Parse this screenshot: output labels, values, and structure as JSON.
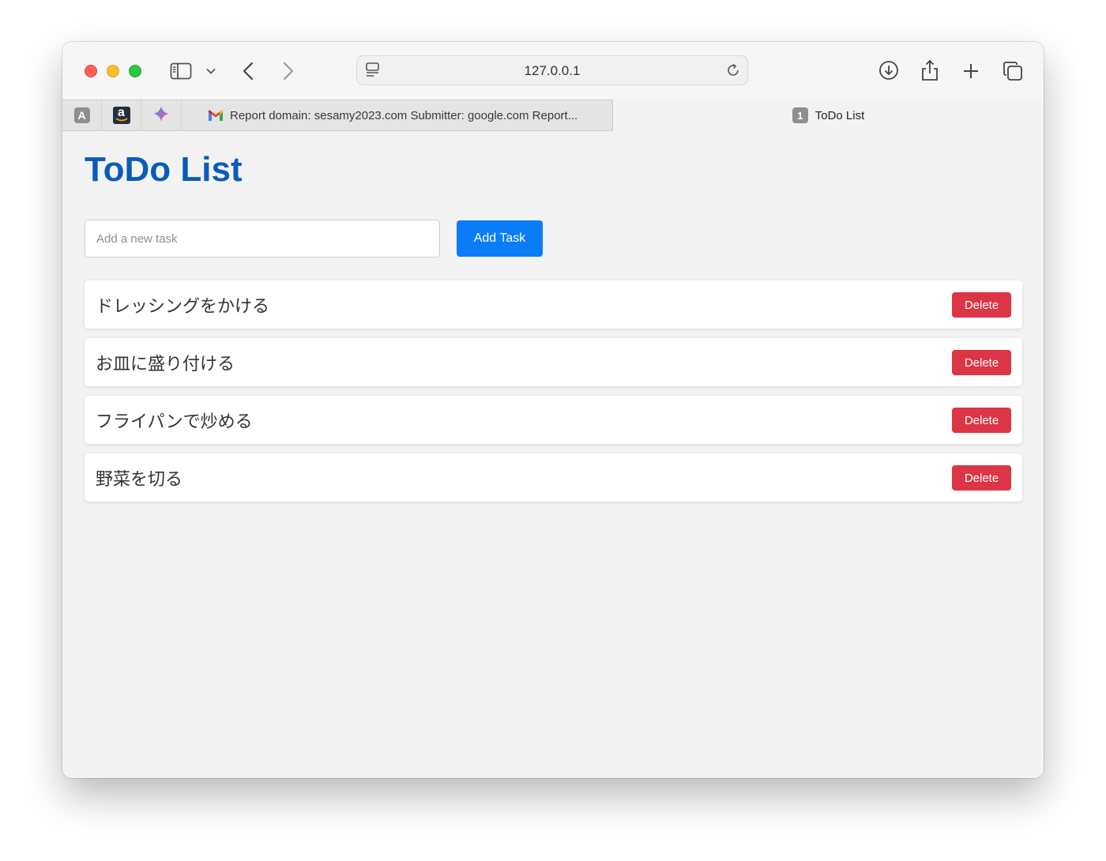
{
  "browser": {
    "url": "127.0.0.1",
    "pinned_tabs": [
      {
        "icon": "a-letter-icon",
        "label": "A"
      },
      {
        "icon": "amazon-icon",
        "label": "a"
      },
      {
        "icon": "sparkle-icon",
        "label": ""
      }
    ],
    "tabs": [
      {
        "title": "Report domain: sesamy2023.com Submitter: google.com Report...",
        "icon": "gmail-icon",
        "active": false
      },
      {
        "title": "ToDo List",
        "badge": "1",
        "active": true
      }
    ]
  },
  "page": {
    "title": "ToDo List",
    "input_placeholder": "Add a new task",
    "input_value": "",
    "add_button_label": "Add Task",
    "tasks": [
      {
        "text": "ドレッシングをかける",
        "delete_label": "Delete"
      },
      {
        "text": "お皿に盛り付ける",
        "delete_label": "Delete"
      },
      {
        "text": "フライパンで炒める",
        "delete_label": "Delete"
      },
      {
        "text": "野菜を切る",
        "delete_label": "Delete"
      }
    ]
  },
  "colors": {
    "title": "#0a5cba",
    "primary_button": "#0a7cf8",
    "danger_button": "#dc3545",
    "page_background": "#f3f3f3"
  }
}
